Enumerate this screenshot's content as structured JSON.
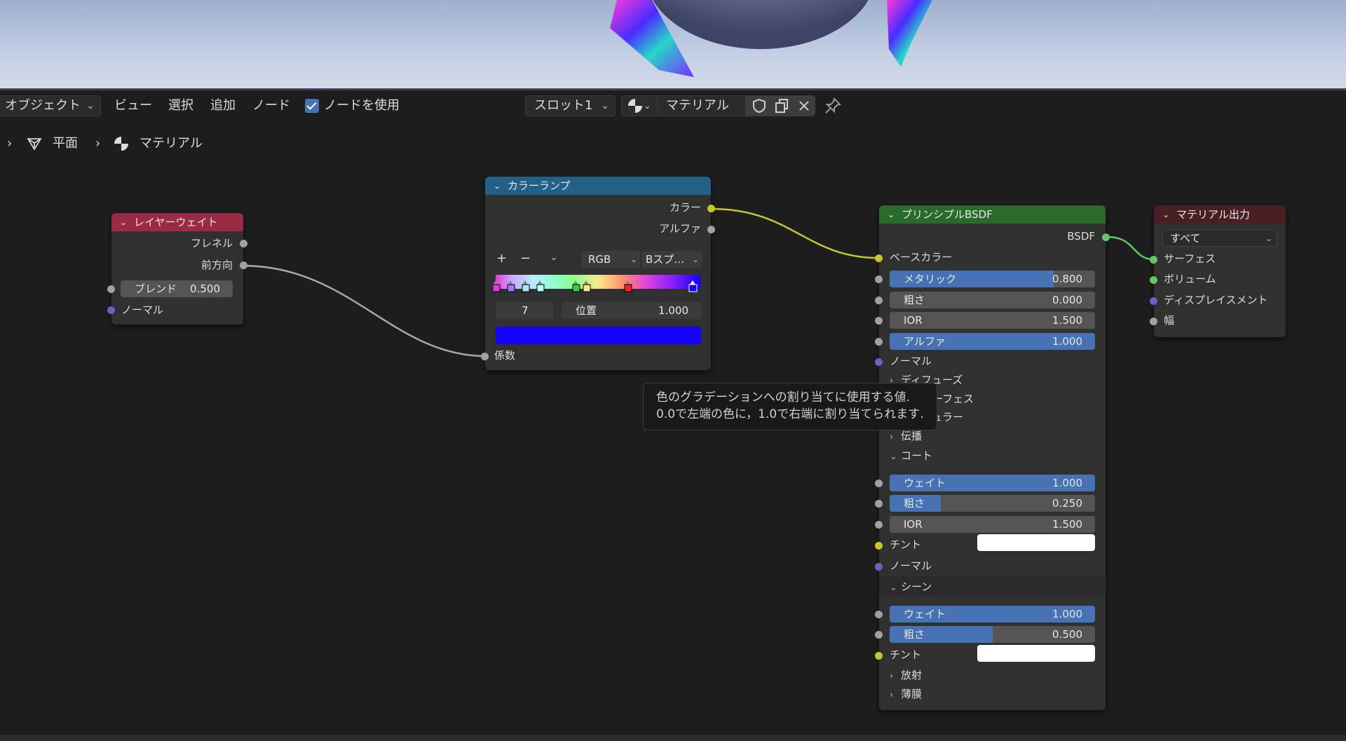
{
  "header": {
    "mode": "オブジェクト",
    "menu": [
      "ビュー",
      "選択",
      "追加",
      "ノード"
    ],
    "use_nodes_label": "ノードを使用",
    "slot": "スロット1",
    "material_name": "マテリアル"
  },
  "breadcrumb": {
    "object": "平面",
    "material": "マテリアル"
  },
  "nodes": {
    "layer_weight": {
      "title": "レイヤーウェイト",
      "out_fresnel": "フレネル",
      "out_facing": "前方向",
      "blend_label": "ブレンド",
      "blend_value": "0.500",
      "normal": "ノーマル",
      "color": "#9b2b43"
    },
    "color_ramp": {
      "title": "カラーランプ",
      "out_color": "カラー",
      "out_alpha": "アルファ",
      "plus": "+",
      "minus": "−",
      "mode": "RGB",
      "interp": "Bスプ…",
      "index": "7",
      "pos_label": "位置",
      "pos_value": "1.000",
      "in_fac": "係数",
      "selected_color": "#1400ff",
      "color": "#226088"
    },
    "principled": {
      "title": "プリンシプルBSDF",
      "out_bsdf": "BSDF",
      "base_color": "ベースカラー",
      "metallic_label": "メタリック",
      "metallic_value": "0.800",
      "metallic": 0.8,
      "roughness_label": "粗さ",
      "roughness_value": "0.000",
      "ior_label": "IOR",
      "ior_value": "1.500",
      "alpha_label": "アルファ",
      "alpha_value": "1.000",
      "alpha": 1.0,
      "normal": "ノーマル",
      "sub_diffuse": "ディフューズ",
      "sub_subsurface": "サブサーフェス",
      "sub_specular": "スペキュラー",
      "sub_transmission": "伝播",
      "coat": "コート",
      "coat_weight_label": "ウェイト",
      "coat_weight_value": "1.000",
      "coat_weight": 1.0,
      "coat_rough_label": "粗さ",
      "coat_rough_value": "0.250",
      "coat_rough": 0.25,
      "coat_ior_label": "IOR",
      "coat_ior_value": "1.500",
      "coat_tint": "チント",
      "coat_normal": "ノーマル",
      "sheen": "シーン",
      "sheen_weight_label": "ウェイト",
      "sheen_weight_value": "1.000",
      "sheen_weight": 1.0,
      "sheen_rough_label": "粗さ",
      "sheen_rough_value": "0.500",
      "sheen_rough": 0.5,
      "sheen_tint": "チント",
      "emission": "放射",
      "thin_film": "薄膜",
      "color": "#2a6a2a"
    },
    "material_output": {
      "title": "マテリアル出力",
      "target": "すべて",
      "surface": "サーフェス",
      "volume": "ボリューム",
      "displacement": "ディスプレイスメント",
      "thickness": "幅",
      "color": "#4a1f24"
    }
  },
  "tooltip": {
    "line1": "色のグラデーションへの割り当てに使用する値.",
    "line2": "0.0で左端の色に，1.0で右端に割り当てられます."
  }
}
